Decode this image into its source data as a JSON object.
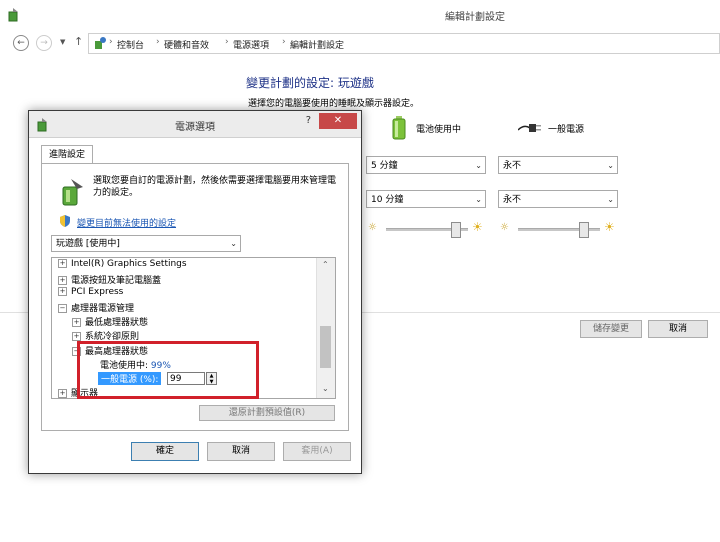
{
  "window": {
    "title": "編輯計劃設定"
  },
  "address_bar": {
    "breadcrumbs": [
      "控制台",
      "硬體和音效",
      "電源選項",
      "編輯計劃設定"
    ]
  },
  "main": {
    "heading": "變更計劃的設定: 玩遊戲",
    "subheading": "選擇您的電腦要使用的睡眠及顯示器設定。",
    "battery_label": "電池使用中",
    "plugged_label": "一般電源",
    "display_off_battery": "5 分鐘",
    "display_off_plugged": "永不",
    "sleep_battery": "10 分鐘",
    "sleep_plugged": "永不",
    "brightness_battery_pct": 88,
    "brightness_plugged_pct": 82,
    "save_button": "儲存變更",
    "cancel_button": "取消"
  },
  "dialog": {
    "title": "電源選項",
    "help": "?",
    "close": "✕",
    "tab": "進階設定",
    "intro": "選取您要自訂的電源計劃，然後依需要選擇電腦要用來管理電力的設定。",
    "change_link": "變更目前無法使用的設定",
    "plan_select": "玩遊戲 [使用中]",
    "tree": [
      {
        "label": "Intel(R) Graphics Settings",
        "box": "+"
      },
      {
        "label": "電源按鈕及筆記電腦蓋",
        "box": "+"
      },
      {
        "label": "PCI Express",
        "box": "+"
      },
      {
        "label": "處理器電源管理",
        "box": "−"
      },
      {
        "label": "最低處理器狀態",
        "box": "+"
      },
      {
        "label": "系統冷卻原則",
        "box": "+"
      },
      {
        "label": "最高處理器狀態",
        "box": "−"
      },
      {
        "label": "電池使用中:",
        "value": "99%"
      },
      {
        "label": "一般電源 (%):",
        "value": "99"
      },
      {
        "label": "顯示器",
        "box": "+"
      }
    ],
    "restore_button": "還原計劃預設值(R)",
    "ok_button": "確定",
    "cancel_button": "取消",
    "apply_button": "套用(A)"
  },
  "colors": {
    "heading": "#1e3287",
    "link": "#1a56b3",
    "highlight": "#3399ff",
    "red_box": "#d1202a",
    "close": "#c74848"
  }
}
